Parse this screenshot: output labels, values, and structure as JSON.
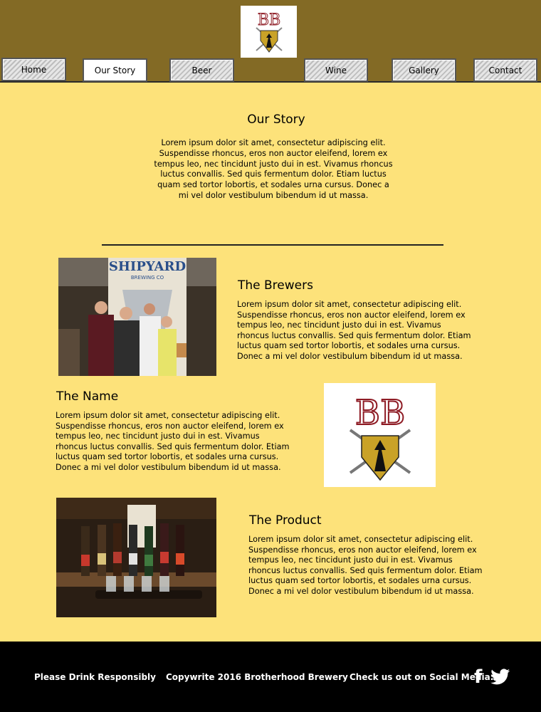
{
  "nav": {
    "home": "Home",
    "our_story": "Our Story",
    "beer": "Beer",
    "wine": "Wine",
    "gallery": "Gallery",
    "contact": "Contact"
  },
  "logo": {
    "letters": "BB"
  },
  "story": {
    "title": "Our Story",
    "text": "Lorem ipsum dolor sit amet, consectetur adipiscing elit. Suspendisse rhoncus, eros non auctor eleifend, lorem ex tempus leo, nec tincidunt justo dui in est. Vivamus rhoncus luctus convallis. Sed quis fermentum dolor. Etiam luctus quam sed tortor lobortis, et sodales urna cursus. Donec a mi vel dolor vestibulum bibendum id ut massa."
  },
  "brewers": {
    "title": "The Brewers",
    "text": "Lorem ipsum dolor sit amet, consectetur adipiscing elit. Suspendisse rhoncus, eros non auctor eleifend, lorem ex tempus leo, nec tincidunt justo dui in est. Vivamus rhoncus luctus convallis. Sed quis fermentum dolor. Etiam luctus quam sed tortor lobortis, et sodales urna cursus. Donec a mi vel dolor vestibulum bibendum id ut massa.",
    "photo_sign": "SHIPYARD",
    "photo_sign_sub": "BREWING CO"
  },
  "name_section": {
    "title": "The Name",
    "text": "Lorem ipsum dolor sit amet, consectetur adipiscing elit. Suspendisse rhoncus, eros non auctor eleifend, lorem ex tempus leo, nec tincidunt justo dui in est. Vivamus rhoncus luctus convallis. Sed quis fermentum dolor. Etiam luctus quam sed tortor lobortis, et sodales urna cursus. Donec a mi vel dolor vestibulum bibendum id ut massa."
  },
  "product": {
    "title": "The Product",
    "text": "Lorem ipsum dolor sit amet, consectetur adipiscing elit. Suspendisse rhoncus, eros non auctor eleifend, lorem ex tempus leo, nec tincidunt justo dui in est. Vivamus rhoncus luctus convallis. Sed quis fermentum dolor. Etiam luctus quam sed tortor lobortis, et sodales urna cursus. Donec a mi vel dolor vestibulum bibendum id ut massa."
  },
  "footer": {
    "drink_responsibly": "Please Drink Responsibly",
    "copyright": "Copywrite 2016 Brotherhood Brewery",
    "social": "Check us out on Social Media:",
    "facebook_glyph": "f"
  },
  "colors": {
    "header_bg": "#836a25",
    "page_bg": "#fde27a",
    "footer_bg": "#000000",
    "logo_red": "#8e1b24",
    "logo_gold": "#c9a227"
  }
}
